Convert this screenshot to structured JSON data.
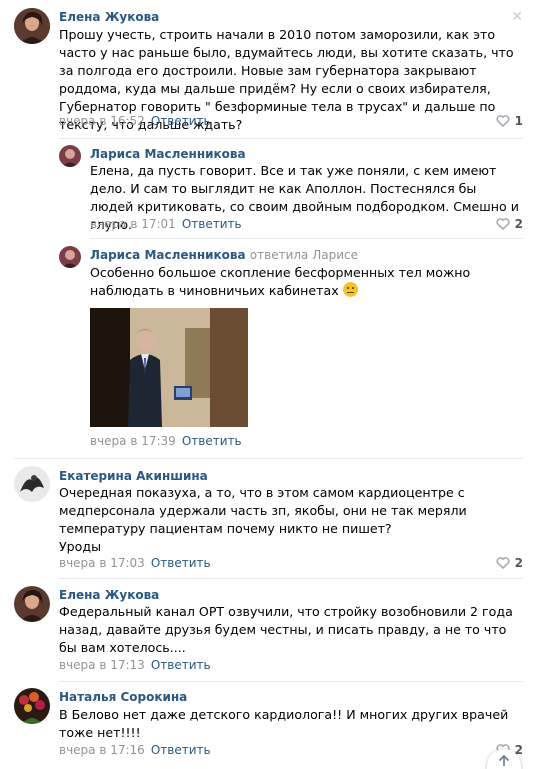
{
  "comments": [
    {
      "author": "Елена Жукова",
      "text": "Прошу учесть, строить начали в 2010 потом заморозили, как это часто у нас раньше было, вдумайтесь люди, вы хотите сказать, что за полгода его достроили. Новые зам губернатора закрывают роддома, куда мы дальше придём? Ну если о своих избирателя, Губернатор говорить \" безформиные тела в трусах\" и дальше по тексту, что дальше ждать?",
      "time": "вчера в 16:52",
      "reply_label": "Ответить",
      "likes": "1"
    },
    {
      "author": "Лариса Масленникова",
      "text": "Елена, да пусть говорит. Все и так уже поняли, с кем имеют дело. И сам то выглядит не как Аполлон. Постеснялся бы людей критиковать, со своим двойным подбородком. Смешно и глупо.",
      "time": "вчера в 17:01",
      "reply_label": "Ответить",
      "likes": "2"
    },
    {
      "author": "Лариса Масленникова",
      "replied_to": "ответила Ларисе",
      "text": "Особенно большое скопление бесформенных тел можно наблюдать в чиновничьих кабинетах",
      "time": "вчера в 17:39",
      "reply_label": "Ответить"
    },
    {
      "author": "Екатерина Акиншина",
      "text": "Очередная показуха, а то, что в этом самом кардиоцентре с медперсонала удержали часть зп, якобы, они не так меряли температуру пациентам почему никто не пишет?",
      "text2": "Уроды",
      "time": "вчера в 17:03",
      "reply_label": "Ответить",
      "likes": "2"
    },
    {
      "author": "Елена Жукова",
      "text": "Федеральный канал ОРТ озвучили, что стройку возобновили 2 года назад, давайте друзья будем честны, и писать правду, а не то что бы вам хотелось....",
      "time": "вчера в 17:13",
      "reply_label": "Ответить"
    },
    {
      "author": "Наталья Сорокина",
      "text": "В Белово нет даже детского кардиолога!! И многих других врачей тоже нет!!!!",
      "time": "вчера в 17:16",
      "reply_label": "Ответить",
      "likes": "2"
    }
  ],
  "colors": {
    "link": "#2a5885",
    "muted": "#939393",
    "separator": "#e7e8ec"
  }
}
